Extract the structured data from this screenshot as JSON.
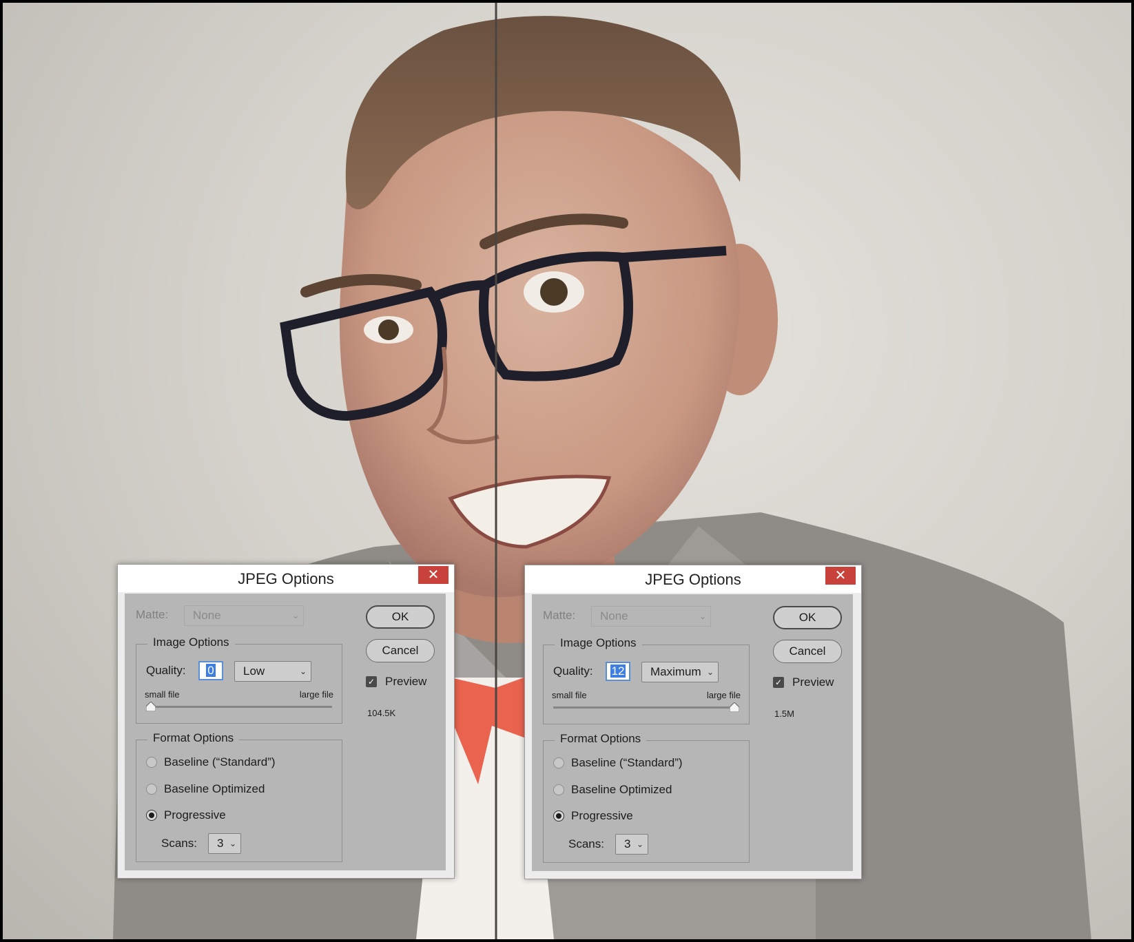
{
  "dialogs": [
    {
      "title": "JPEG Options",
      "close_glyph": "✕",
      "matte_label": "Matte:",
      "matte_value": "None",
      "image_options_title": "Image Options",
      "quality_label": "Quality:",
      "quality_value": "0",
      "quality_preset": "Low",
      "slider_min_label": "small file",
      "slider_max_label": "large file",
      "slider_position": 0,
      "format_options_title": "Format Options",
      "format_options": [
        "Baseline (“Standard”)",
        "Baseline Optimized",
        "Progressive"
      ],
      "selected_format": "Progressive",
      "scans_label": "Scans:",
      "scans_value": "3",
      "ok_label": "OK",
      "cancel_label": "Cancel",
      "preview_label": "Preview",
      "preview_checked": true,
      "file_size": "104.5K"
    },
    {
      "title": "JPEG Options",
      "close_glyph": "✕",
      "matte_label": "Matte:",
      "matte_value": "None",
      "image_options_title": "Image Options",
      "quality_label": "Quality:",
      "quality_value": "12",
      "quality_preset": "Maximum",
      "slider_min_label": "small file",
      "slider_max_label": "large file",
      "slider_position": 1,
      "format_options_title": "Format Options",
      "format_options": [
        "Baseline (“Standard”)",
        "Baseline Optimized",
        "Progressive"
      ],
      "selected_format": "Progressive",
      "scans_label": "Scans:",
      "scans_value": "3",
      "ok_label": "OK",
      "cancel_label": "Cancel",
      "preview_label": "Preview",
      "preview_checked": true,
      "file_size": "1.5M"
    }
  ],
  "icons": {
    "close": "close-icon",
    "chevron": "chevron-down-icon",
    "check": "check-icon"
  },
  "colors": {
    "close_button": "#c9413b",
    "selection": "#3d7ee0",
    "bow_tie": "#e9634f"
  }
}
